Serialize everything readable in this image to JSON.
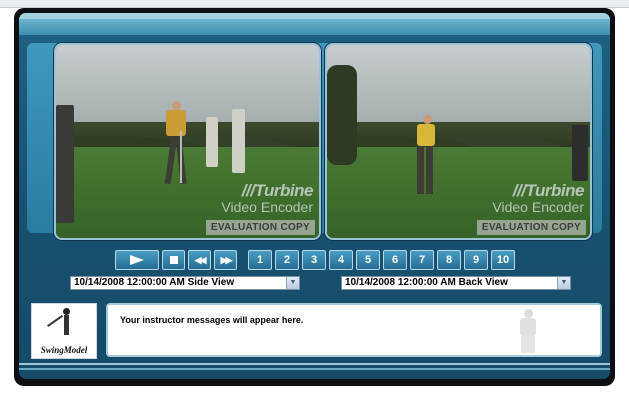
{
  "videos": {
    "side": {
      "watermark_brand": "///Turbine",
      "watermark_sub": "Video Encoder",
      "eval_label": "EVALUATION COPY"
    },
    "back": {
      "watermark_brand": "///Turbine",
      "watermark_sub": "Video Encoder",
      "eval_label": "EVALUATION COPY"
    }
  },
  "controls": {
    "play_icon": "play-icon",
    "stop_icon": "stop-icon",
    "rewind_label": "◀◀",
    "forward_label": "▶▶",
    "numbers": [
      "1",
      "2",
      "3",
      "4",
      "5",
      "6",
      "7",
      "8",
      "9",
      "10"
    ]
  },
  "selectors": {
    "side": "10/14/2008 12:00:00 AM Side View",
    "back": "10/14/2008 12:00:00 AM Back View",
    "arrow": "▼"
  },
  "logo": {
    "name": "SwingModel"
  },
  "message": {
    "text": "Your instructor messages will appear here."
  },
  "colors": {
    "frame": "#1e5f82",
    "band": "#7fc0d6",
    "button": "#2f7ea6",
    "border": "#0d0f12"
  }
}
